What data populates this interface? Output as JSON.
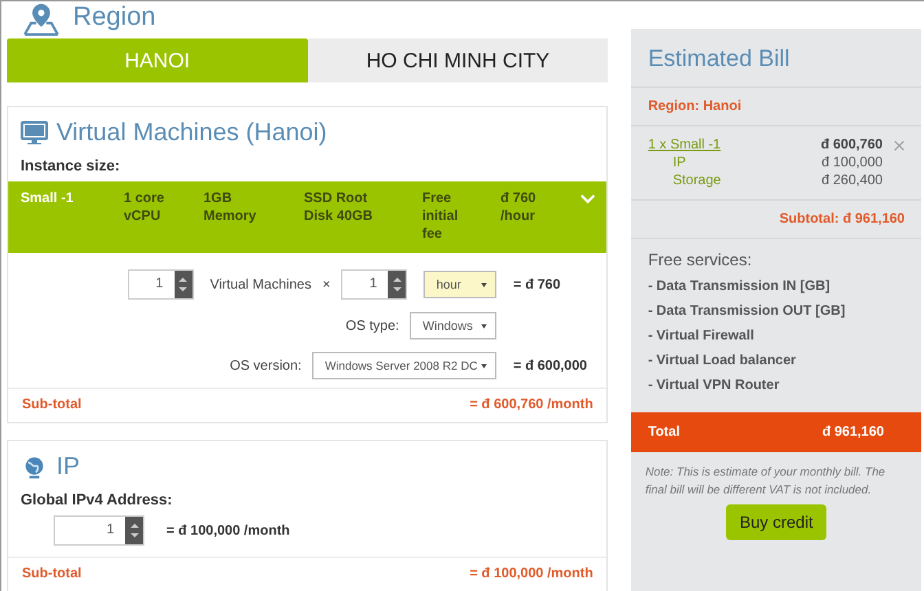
{
  "region": {
    "title": "Region",
    "tabs": [
      {
        "label": "HANOI",
        "selected": true
      },
      {
        "label": "HO CHI MINH CITY",
        "selected": false
      }
    ]
  },
  "vm": {
    "title": "Virtual Machines (Hanoi)",
    "instance_label": "Instance size:",
    "instance": {
      "name": "Small -1",
      "specs": [
        "1 core vCPU",
        "1GB Memory",
        "SSD Root Disk 40GB",
        "Free initial fee",
        "đ 760 /hour"
      ],
      "expanded": true
    },
    "count": "1",
    "count_label": "Virtual Machines",
    "times": "×",
    "duration": "1",
    "unit": "hour",
    "unit_result": "= đ 760",
    "os_type_label": "OS type:",
    "os_type": "Windows",
    "os_version_label": "OS version:",
    "os_version": "Windows Server 2008 R2 DC",
    "os_result": "= đ 600,000",
    "subtotal_label": "Sub-total",
    "subtotal": "= đ 600,760 /month"
  },
  "ip": {
    "title": "IP",
    "address_label": "Global IPv4 Address:",
    "count": "1",
    "result": "= đ 100,000 /month",
    "subtotal_label": "Sub-total",
    "subtotal": "= đ 100,000 /month"
  },
  "bill": {
    "title": "Estimated Bill",
    "region": "Region: Hanoi",
    "lines": [
      {
        "label": "1 x Small -1",
        "amount": "đ 600,760",
        "kind": "main"
      },
      {
        "label": "IP",
        "amount": "đ 100,000",
        "kind": "sub"
      },
      {
        "label": "Storage",
        "amount": "đ 260,400",
        "kind": "sub"
      }
    ],
    "subtotal": "Subtotal: đ 961,160",
    "free_title": "Free services:",
    "free": [
      "- Data Transmission IN [GB]",
      "- Data Transmission OUT [GB]",
      "- Virtual Firewall",
      "- Virtual Load balancer",
      "- Virtual VPN Router"
    ],
    "total_label": "Total",
    "total": "đ 961,160",
    "note": "Note: This is estimate of your monthly bill. The final bill will be different VAT is not included.",
    "button": "Buy credit"
  }
}
